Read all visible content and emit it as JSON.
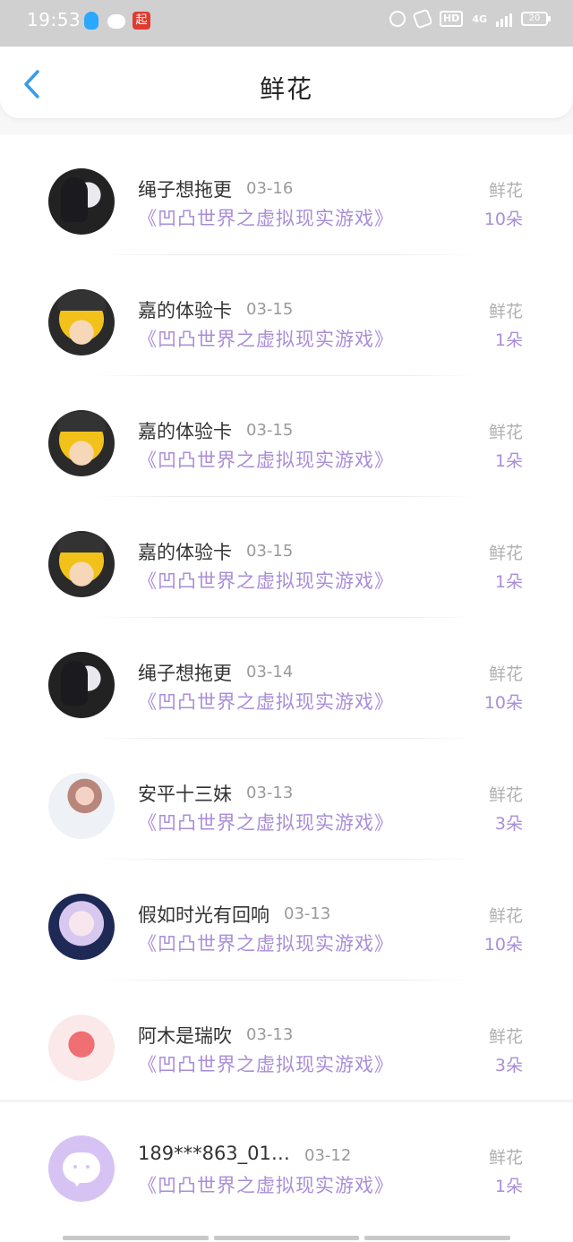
{
  "status_bar": {
    "time": "19:53",
    "network": "4G",
    "hd_badge": "HD",
    "battery": "20",
    "app_badge": "起"
  },
  "nav": {
    "title": "鲜花",
    "back_icon": "chevron-left-icon"
  },
  "colors": {
    "accent_purple": "#a98ed8",
    "back_blue": "#3a9ce8",
    "status_bar_bg": "#d0d0d0"
  },
  "list": {
    "items": [
      {
        "name": "绳子想拖更",
        "date": "03-16",
        "book": "《凹凸世界之虚拟现实游戏》",
        "type": "鲜花",
        "count": "10朵",
        "avatar": "dark"
      },
      {
        "name": "嘉的体验卡",
        "date": "03-15",
        "book": "《凹凸世界之虚拟现实游戏》",
        "type": "鲜花",
        "count": "1朵",
        "avatar": "gold"
      },
      {
        "name": "嘉的体验卡",
        "date": "03-15",
        "book": "《凹凸世界之虚拟现实游戏》",
        "type": "鲜花",
        "count": "1朵",
        "avatar": "gold"
      },
      {
        "name": "嘉的体验卡",
        "date": "03-15",
        "book": "《凹凸世界之虚拟现实游戏》",
        "type": "鲜花",
        "count": "1朵",
        "avatar": "gold"
      },
      {
        "name": "绳子想拖更",
        "date": "03-14",
        "book": "《凹凸世界之虚拟现实游戏》",
        "type": "鲜花",
        "count": "10朵",
        "avatar": "dark"
      },
      {
        "name": "安平十三妹",
        "date": "03-13",
        "book": "《凹凸世界之虚拟现实游戏》",
        "type": "鲜花",
        "count": "3朵",
        "avatar": "light"
      },
      {
        "name": "假如时光有回响",
        "date": "03-13",
        "book": "《凹凸世界之虚拟现实游戏》",
        "type": "鲜花",
        "count": "10朵",
        "avatar": "anime"
      },
      {
        "name": "阿木是瑞吹",
        "date": "03-13",
        "book": "《凹凸世界之虚拟现实游戏》",
        "type": "鲜花",
        "count": "3朵",
        "avatar": "pink"
      },
      {
        "name": "189***863_01…",
        "date": "03-12",
        "book": "《凹凸世界之虚拟现实游戏》",
        "type": "鲜花",
        "count": "1朵",
        "avatar": "default"
      }
    ]
  }
}
